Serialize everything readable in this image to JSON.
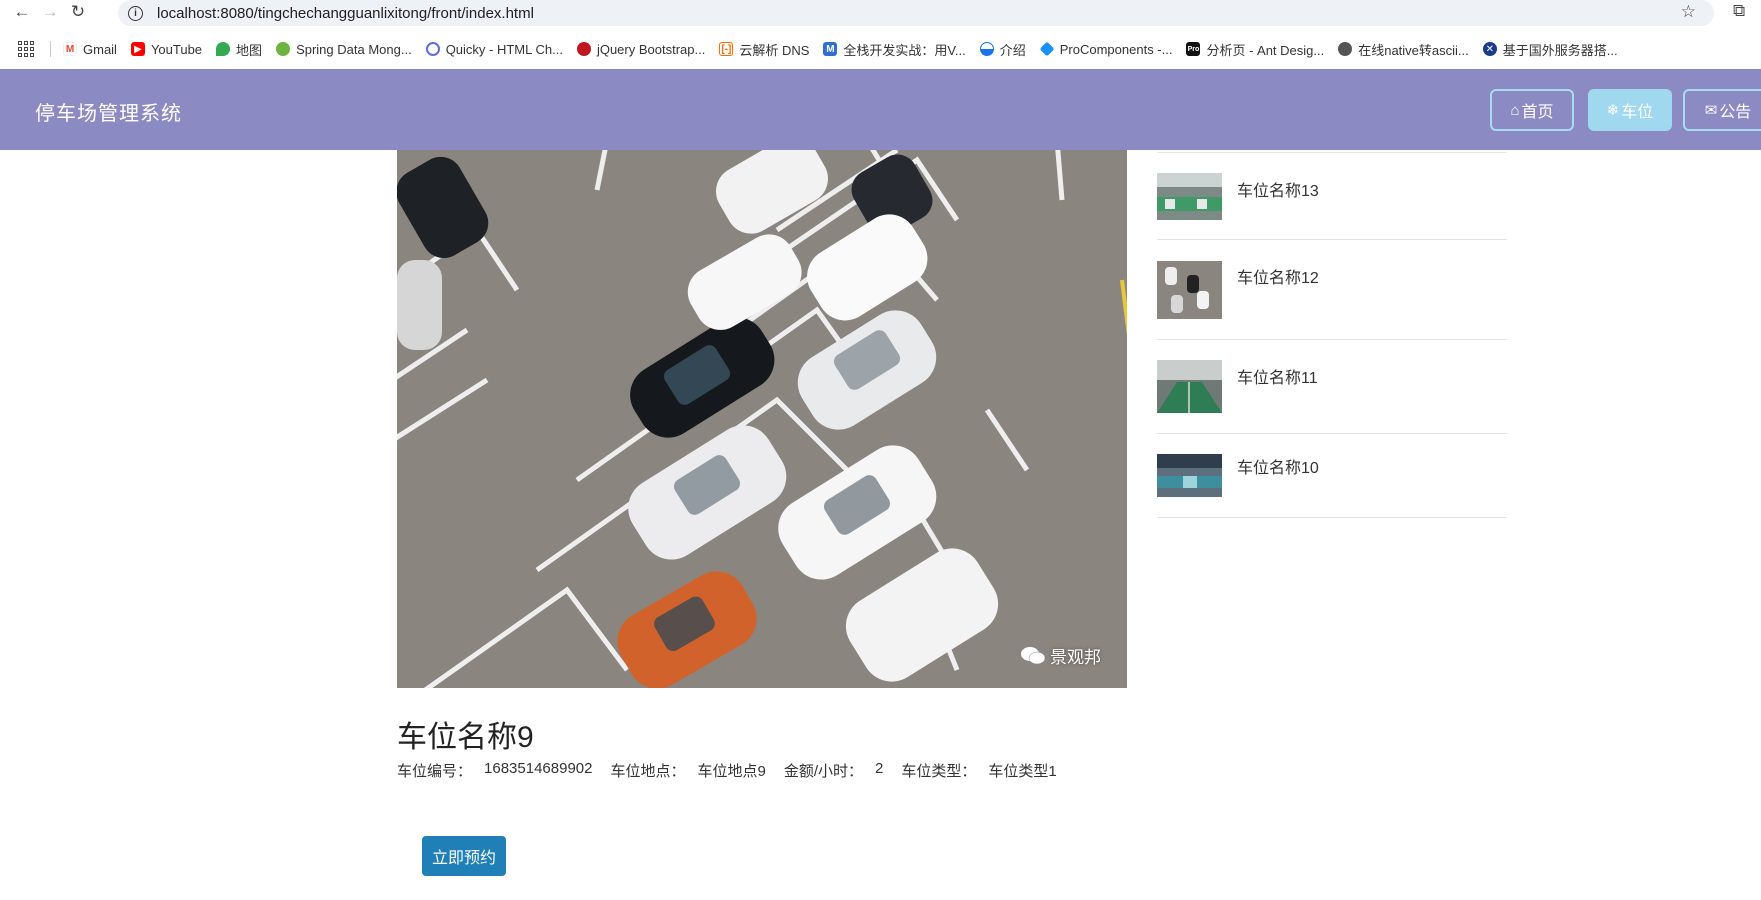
{
  "browser": {
    "url": "localhost:8080/tingchechangguanlixitong/front/index.html",
    "back_icon": "arrow-left-icon",
    "forward_icon": "arrow-right-icon",
    "reload_icon": "reload-icon",
    "bookmarks": [
      {
        "label": "Gmail",
        "icon": "gmail-icon",
        "color": "#ea4335"
      },
      {
        "label": "YouTube",
        "icon": "youtube-icon",
        "color": "#ff0000"
      },
      {
        "label": "地图",
        "icon": "maps-icon",
        "color": "#34a853"
      },
      {
        "label": "Spring Data Mong...",
        "icon": "spring-icon",
        "color": "#6db33f"
      },
      {
        "label": "Quicky - HTML Ch...",
        "icon": "quicky-icon",
        "color": "#5b6ee1"
      },
      {
        "label": "jQuery Bootstrap...",
        "icon": "jquery-icon",
        "color": "#c0161d"
      },
      {
        "label": "云解析 DNS",
        "icon": "aliyun-icon",
        "color": "#ff6a00"
      },
      {
        "label": "全栈开发实战：用V...",
        "icon": "m-icon",
        "color": "#2f6fd1"
      },
      {
        "label": "介绍",
        "icon": "globe-icon",
        "color": "#1a73e8"
      },
      {
        "label": "ProComponents -...",
        "icon": "antd-icon",
        "color": "#1890ff"
      },
      {
        "label": "分析页 - Ant Desig...",
        "icon": "pro-icon",
        "color": "#111111"
      },
      {
        "label": "在线native转ascii...",
        "icon": "world-icon",
        "color": "#555555"
      },
      {
        "label": "基于国外服务器搭...",
        "icon": "flag-icon",
        "color": "#1a3a8c"
      }
    ]
  },
  "header": {
    "title": "停车场管理系统",
    "nav": [
      {
        "label": "首页",
        "icon": "home-icon"
      },
      {
        "label": "车位",
        "icon": "snowflake-icon"
      },
      {
        "label": "公告",
        "icon": "mail-icon"
      }
    ],
    "bg_color": "#8c8ac3",
    "active_color": "#a0d8ef"
  },
  "detail": {
    "name": "车位名称9",
    "watermark": "景观邦",
    "fields": [
      {
        "label": "车位编号：",
        "value": "1683514689902"
      },
      {
        "label": "车位地点：",
        "value": "车位地点9"
      },
      {
        "label": "金额/小时：",
        "value": "2"
      },
      {
        "label": "车位类型：",
        "value": "车位类型1"
      }
    ],
    "reserve_label": "立即预约",
    "button_color": "#1f7fb6"
  },
  "sidebar": {
    "items": [
      {
        "name": "车位名称13"
      },
      {
        "name": "车位名称12"
      },
      {
        "name": "车位名称11"
      },
      {
        "name": "车位名称10"
      }
    ]
  }
}
